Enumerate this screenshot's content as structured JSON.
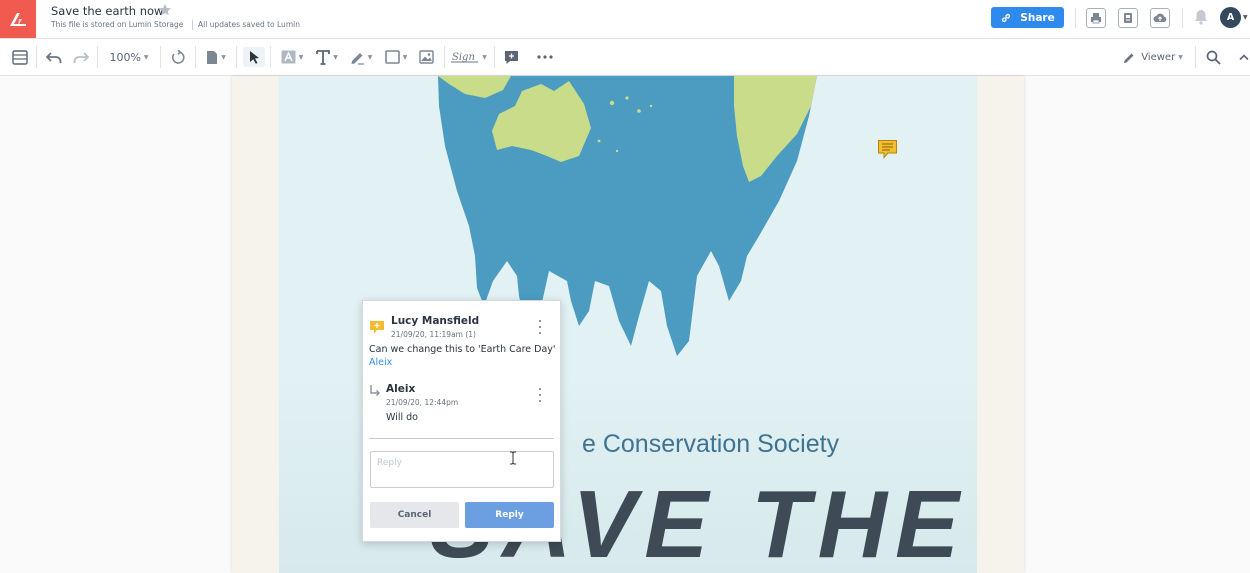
{
  "header": {
    "doc_title": "Save the earth now",
    "storage_note": "This file is stored on Lumin Storage",
    "save_status": "All updates saved to Lumin",
    "share_label": "Share",
    "avatar_initial": "A"
  },
  "toolbar": {
    "zoom": "100%",
    "sign_label": "Sign",
    "viewer_label": "Viewer"
  },
  "poster": {
    "heading": "e Conservation Society",
    "big_text": "SAVE THE"
  },
  "comment": {
    "author": "Lucy Mansfield",
    "timestamp": "21/09/20, 11:19am (1)",
    "text": "Can we change this to 'Earth Care Day'",
    "mention": "Aleix",
    "reply": {
      "author": "Aleix",
      "timestamp": "21/09/20, 12:44pm",
      "text": "Will do"
    },
    "reply_placeholder": "Reply",
    "cancel_label": "Cancel",
    "reply_button_label": "Reply"
  },
  "colors": {
    "brand": "#f05a4f",
    "accent": "#2e8bed",
    "ocean": "#4b9cc0",
    "land": "#c9dc8a",
    "heading": "#3d7393"
  }
}
